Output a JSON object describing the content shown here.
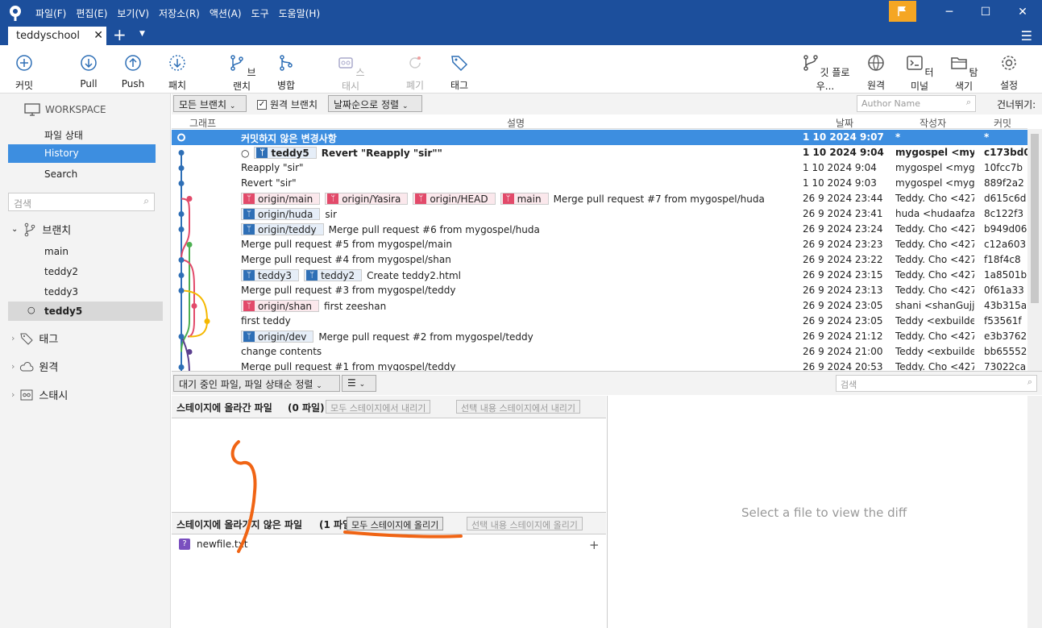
{
  "menu": [
    "파일(F)",
    "편집(E)",
    "보기(V)",
    "저장소(R)",
    "액션(A)",
    "도구",
    "도움말(H)"
  ],
  "tab": {
    "label": "teddyschool"
  },
  "toolbar": {
    "commit": "커밋",
    "pull": "Pull",
    "push": "Push",
    "patch": "패치",
    "branch": "브랜치",
    "merge": "병합",
    "stash": "스태시",
    "discard": "폐기",
    "tag": "태그",
    "gitflow": "깃 플로우...",
    "remote": "원격",
    "terminal": "터미널",
    "explorer": "탐색기",
    "settings": "설정"
  },
  "sidebar": {
    "workspace": "WORKSPACE",
    "file_status": "파일 상태",
    "history": "History",
    "search": "Search",
    "search_placeholder": "검색",
    "branches_label": "브랜치",
    "branches": [
      "main",
      "teddy2",
      "teddy3",
      "teddy5"
    ],
    "current_branch": "teddy5",
    "tags_label": "태그",
    "remotes_label": "원격",
    "stashes_label": "스태시"
  },
  "filters": {
    "all_branches": "모든 브랜치",
    "remote_branches": "원격 브랜치",
    "sort": "날짜순으로 정렬",
    "author_placeholder": "Author Name",
    "skip": "건너뛰기:"
  },
  "columns": {
    "graph": "그래프",
    "desc": "설명",
    "date": "날짜",
    "author": "작성자",
    "commit": "커밋"
  },
  "commits": [
    {
      "tags": [],
      "desc": "커밋하지 않은 변경사항",
      "date": "1 10 2024 9:07",
      "author": "*",
      "commit": "*"
    },
    {
      "tags": [
        {
          "t": "teddy5",
          "c": "blue"
        }
      ],
      "desc": "Revert \"Reapply \"sir\"\"",
      "date": "1 10 2024 9:04",
      "author": "mygospel <mygospel",
      "commit": "c173bd0"
    },
    {
      "tags": [],
      "desc": "Reapply \"sir\"",
      "date": "1 10 2024 9:04",
      "author": "mygospel <mygospel",
      "commit": "10fcc7b"
    },
    {
      "tags": [],
      "desc": "Revert \"sir\"",
      "date": "1 10 2024 9:03",
      "author": "mygospel <mygospel",
      "commit": "889f2a2"
    },
    {
      "tags": [
        {
          "t": "origin/main",
          "c": "red"
        },
        {
          "t": "origin/Yasira",
          "c": "red"
        },
        {
          "t": "origin/HEAD",
          "c": "red"
        },
        {
          "t": "main",
          "c": "red"
        }
      ],
      "desc": "Merge pull request #7 from mygospel/huda",
      "date": "26 9 2024 23:44",
      "author": "Teddy. Cho <4272",
      "commit": "d615c6d"
    },
    {
      "tags": [
        {
          "t": "origin/huda",
          "c": "blue"
        }
      ],
      "desc": "sir",
      "date": "26 9 2024 23:41",
      "author": "huda <hudaafzaal",
      "commit": "8c122f3"
    },
    {
      "tags": [
        {
          "t": "origin/teddy",
          "c": "blue"
        }
      ],
      "desc": "Merge pull request #6 from mygospel/huda",
      "date": "26 9 2024 23:24",
      "author": "Teddy. Cho <4272",
      "commit": "b949d06"
    },
    {
      "tags": [],
      "desc": "Merge pull request #5 from mygospel/main",
      "date": "26 9 2024 23:23",
      "author": "Teddy. Cho <4272",
      "commit": "c12a603"
    },
    {
      "tags": [],
      "desc": "Merge pull request #4 from mygospel/shan",
      "date": "26 9 2024 23:22",
      "author": "Teddy. Cho <4272",
      "commit": "f18f4c8"
    },
    {
      "tags": [
        {
          "t": "teddy3",
          "c": "blue"
        },
        {
          "t": "teddy2",
          "c": "blue"
        }
      ],
      "desc": "Create teddy2.html",
      "date": "26 9 2024 23:15",
      "author": "Teddy. Cho <4272",
      "commit": "1a8501b"
    },
    {
      "tags": [],
      "desc": "Merge pull request #3 from mygospel/teddy",
      "date": "26 9 2024 23:13",
      "author": "Teddy. Cho <4272",
      "commit": "0f61a33"
    },
    {
      "tags": [
        {
          "t": "origin/shan",
          "c": "red"
        }
      ],
      "desc": "first zeeshan",
      "date": "26 9 2024 23:05",
      "author": "shani <shanGujjar",
      "commit": "43b315a"
    },
    {
      "tags": [],
      "desc": "first teddy",
      "date": "26 9 2024 23:05",
      "author": "Teddy <exbuilder@",
      "commit": "f53561f"
    },
    {
      "tags": [
        {
          "t": "origin/dev",
          "c": "blue"
        }
      ],
      "desc": "Merge pull request #2 from mygospel/teddy",
      "date": "26 9 2024 21:12",
      "author": "Teddy. Cho <4272",
      "commit": "e3b3762"
    },
    {
      "tags": [],
      "desc": "change contents",
      "date": "26 9 2024 21:00",
      "author": "Teddy <exbuilder@",
      "commit": "bb65552"
    },
    {
      "tags": [],
      "desc": "Merge pull request #1 from mygospel/teddy",
      "date": "26 9 2024 20:53",
      "author": "Teddy. Cho <4272",
      "commit": "73022ca"
    }
  ],
  "midbar": {
    "pending": "대기 중인 파일, 파일 상태순 정렬",
    "search_placeholder": "검색"
  },
  "staged": {
    "title": "스테이지에 올라간 파일",
    "count": "(0 파일)",
    "unstage_all": "모두 스테이지에서 내리기",
    "unstage_sel": "선택 내용 스테이지에서 내리기"
  },
  "unstaged": {
    "title": "스테이지에 올라가지 않은 파일",
    "count": "(1 파일)",
    "stage_all": "모두 스테이지에 올리기",
    "stage_sel": "선택 내용 스테이지에 올리기"
  },
  "files": [
    "newfile.txt"
  ],
  "diff": {
    "empty": "Select a file to view the diff"
  },
  "colors": {
    "accent": "#1c4f9c",
    "selection": "#3d8ee0",
    "annotation": "#f06414"
  }
}
